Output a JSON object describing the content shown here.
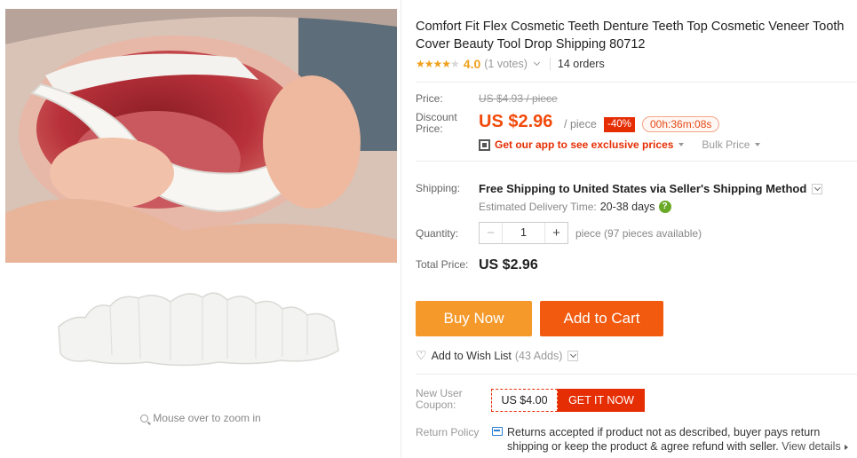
{
  "gallery": {
    "zoom_hint": "Mouse over to zoom in"
  },
  "product": {
    "title": "Comfort Fit Flex Cosmetic Teeth Denture Teeth Top Cosmetic Veneer Tooth Cover Beauty Tool Drop Shipping 80712",
    "rating": "4.0",
    "stars_filled": 4,
    "votes": "(1 votes)",
    "orders": "14 orders"
  },
  "price": {
    "price_label": "Price:",
    "old_price": "US $4.93 / piece",
    "discount_label": "Discount Price:",
    "new_price": "US $2.96",
    "per_piece": "/ piece",
    "discount_pct": "-40%",
    "countdown": "00h:36m:08s",
    "app_link": "Get our app to see exclusive prices",
    "bulk_price": "Bulk Price"
  },
  "shipping": {
    "label": "Shipping:",
    "method": "Free Shipping to United States via Seller's Shipping Method",
    "delivery_label": "Estimated Delivery Time:",
    "delivery_days": "20-38 days",
    "help_icon": "?"
  },
  "quantity": {
    "label": "Quantity:",
    "minus": "−",
    "value": "1",
    "plus": "+",
    "availability": "piece (97 pieces available)"
  },
  "total": {
    "label": "Total Price:",
    "value": "US $2.96"
  },
  "actions": {
    "buy_now": "Buy Now",
    "add_to_cart": "Add to Cart",
    "wishlist": "Add to Wish List",
    "wishlist_count": "(43 Adds)"
  },
  "coupon": {
    "label": "New User Coupon:",
    "amount": "US $4.00",
    "get_it": "GET IT NOW"
  },
  "return_policy": {
    "label": "Return Policy",
    "text": "Returns accepted if product not as described, buyer pays return shipping or keep the product & agree refund with seller.",
    "link": "View details"
  },
  "colors": {
    "price_red": "#f24a0b",
    "buy_orange": "#f5992b",
    "cart_orange": "#f15a0f",
    "coupon_red": "#e62e04",
    "star": "#f0a11c"
  }
}
